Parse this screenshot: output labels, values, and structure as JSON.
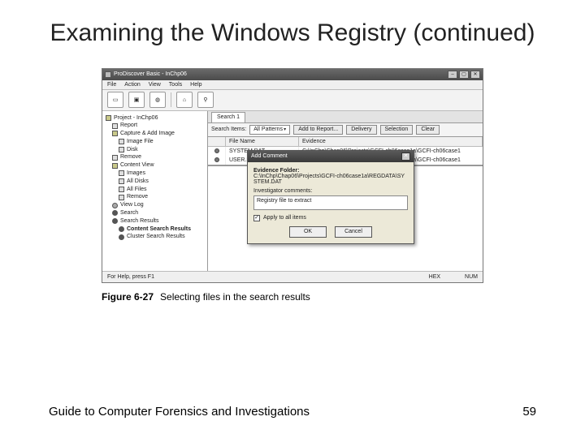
{
  "slide": {
    "title": "Examining the Windows Registry (continued)",
    "footer_left": "Guide to Computer Forensics and Investigations",
    "page_number": "59"
  },
  "figure": {
    "number": "Figure 6-27",
    "caption": "Selecting files in the search results"
  },
  "app": {
    "window_title": "ProDiscover Basic - InChp06",
    "menu": {
      "file": "File",
      "action": "Action",
      "view": "View",
      "tools": "Tools",
      "help": "Help"
    },
    "tree": {
      "root": "Project - InChp06",
      "report": "Report",
      "add": "Capture & Add Image",
      "imagefile": "Image File",
      "disk": "Disk",
      "remove": "Remove",
      "contentview": "Content View",
      "images": "Images",
      "alldisks": "All Disks",
      "allfiles": "All Files",
      "remove2": "Remove",
      "viewlog": "View Log",
      "search": "Search",
      "searchresults": "Search Results",
      "contentsearch": "Content Search Results",
      "clustersearch": "Cluster Search Results"
    },
    "search_tab": "Search 1",
    "searchbar": {
      "label": "Search Items:",
      "dropdown": "All Patterns",
      "add_report": "Add to Report...",
      "delivery": "Delivery",
      "selection": "Selection",
      "clear": "Clear"
    },
    "columns": {
      "status": "",
      "name": "File Name",
      "evidence": "Evidence"
    },
    "rows": [
      {
        "name": "SYSTEM.DAT",
        "evidence": "C:\\InChp\\Chap06\\Projects\\GCFI-ch06case1a\\GCFI-ch06case1"
      },
      {
        "name": "USER.DAT",
        "evidence": "C:\\InChp\\Chap06\\Projects\\GCFI-ch06case1a\\GCFI-ch06case1"
      }
    ],
    "statusbar": {
      "left": "For Help, press F1",
      "mid": "HEX",
      "right": "NUM"
    }
  },
  "dialog": {
    "title": "Add Comment",
    "label_path": "Evidence Folder:",
    "path_value": "C:\\InChp\\Chap06\\Projects\\GCFI-ch06case1a\\REGDATA\\SYSTEM.DAT",
    "label_comment": "Investigator comments:",
    "comment_value": "Registry file to extract",
    "checkbox": "Apply to all items",
    "ok": "OK",
    "cancel": "Cancel"
  }
}
